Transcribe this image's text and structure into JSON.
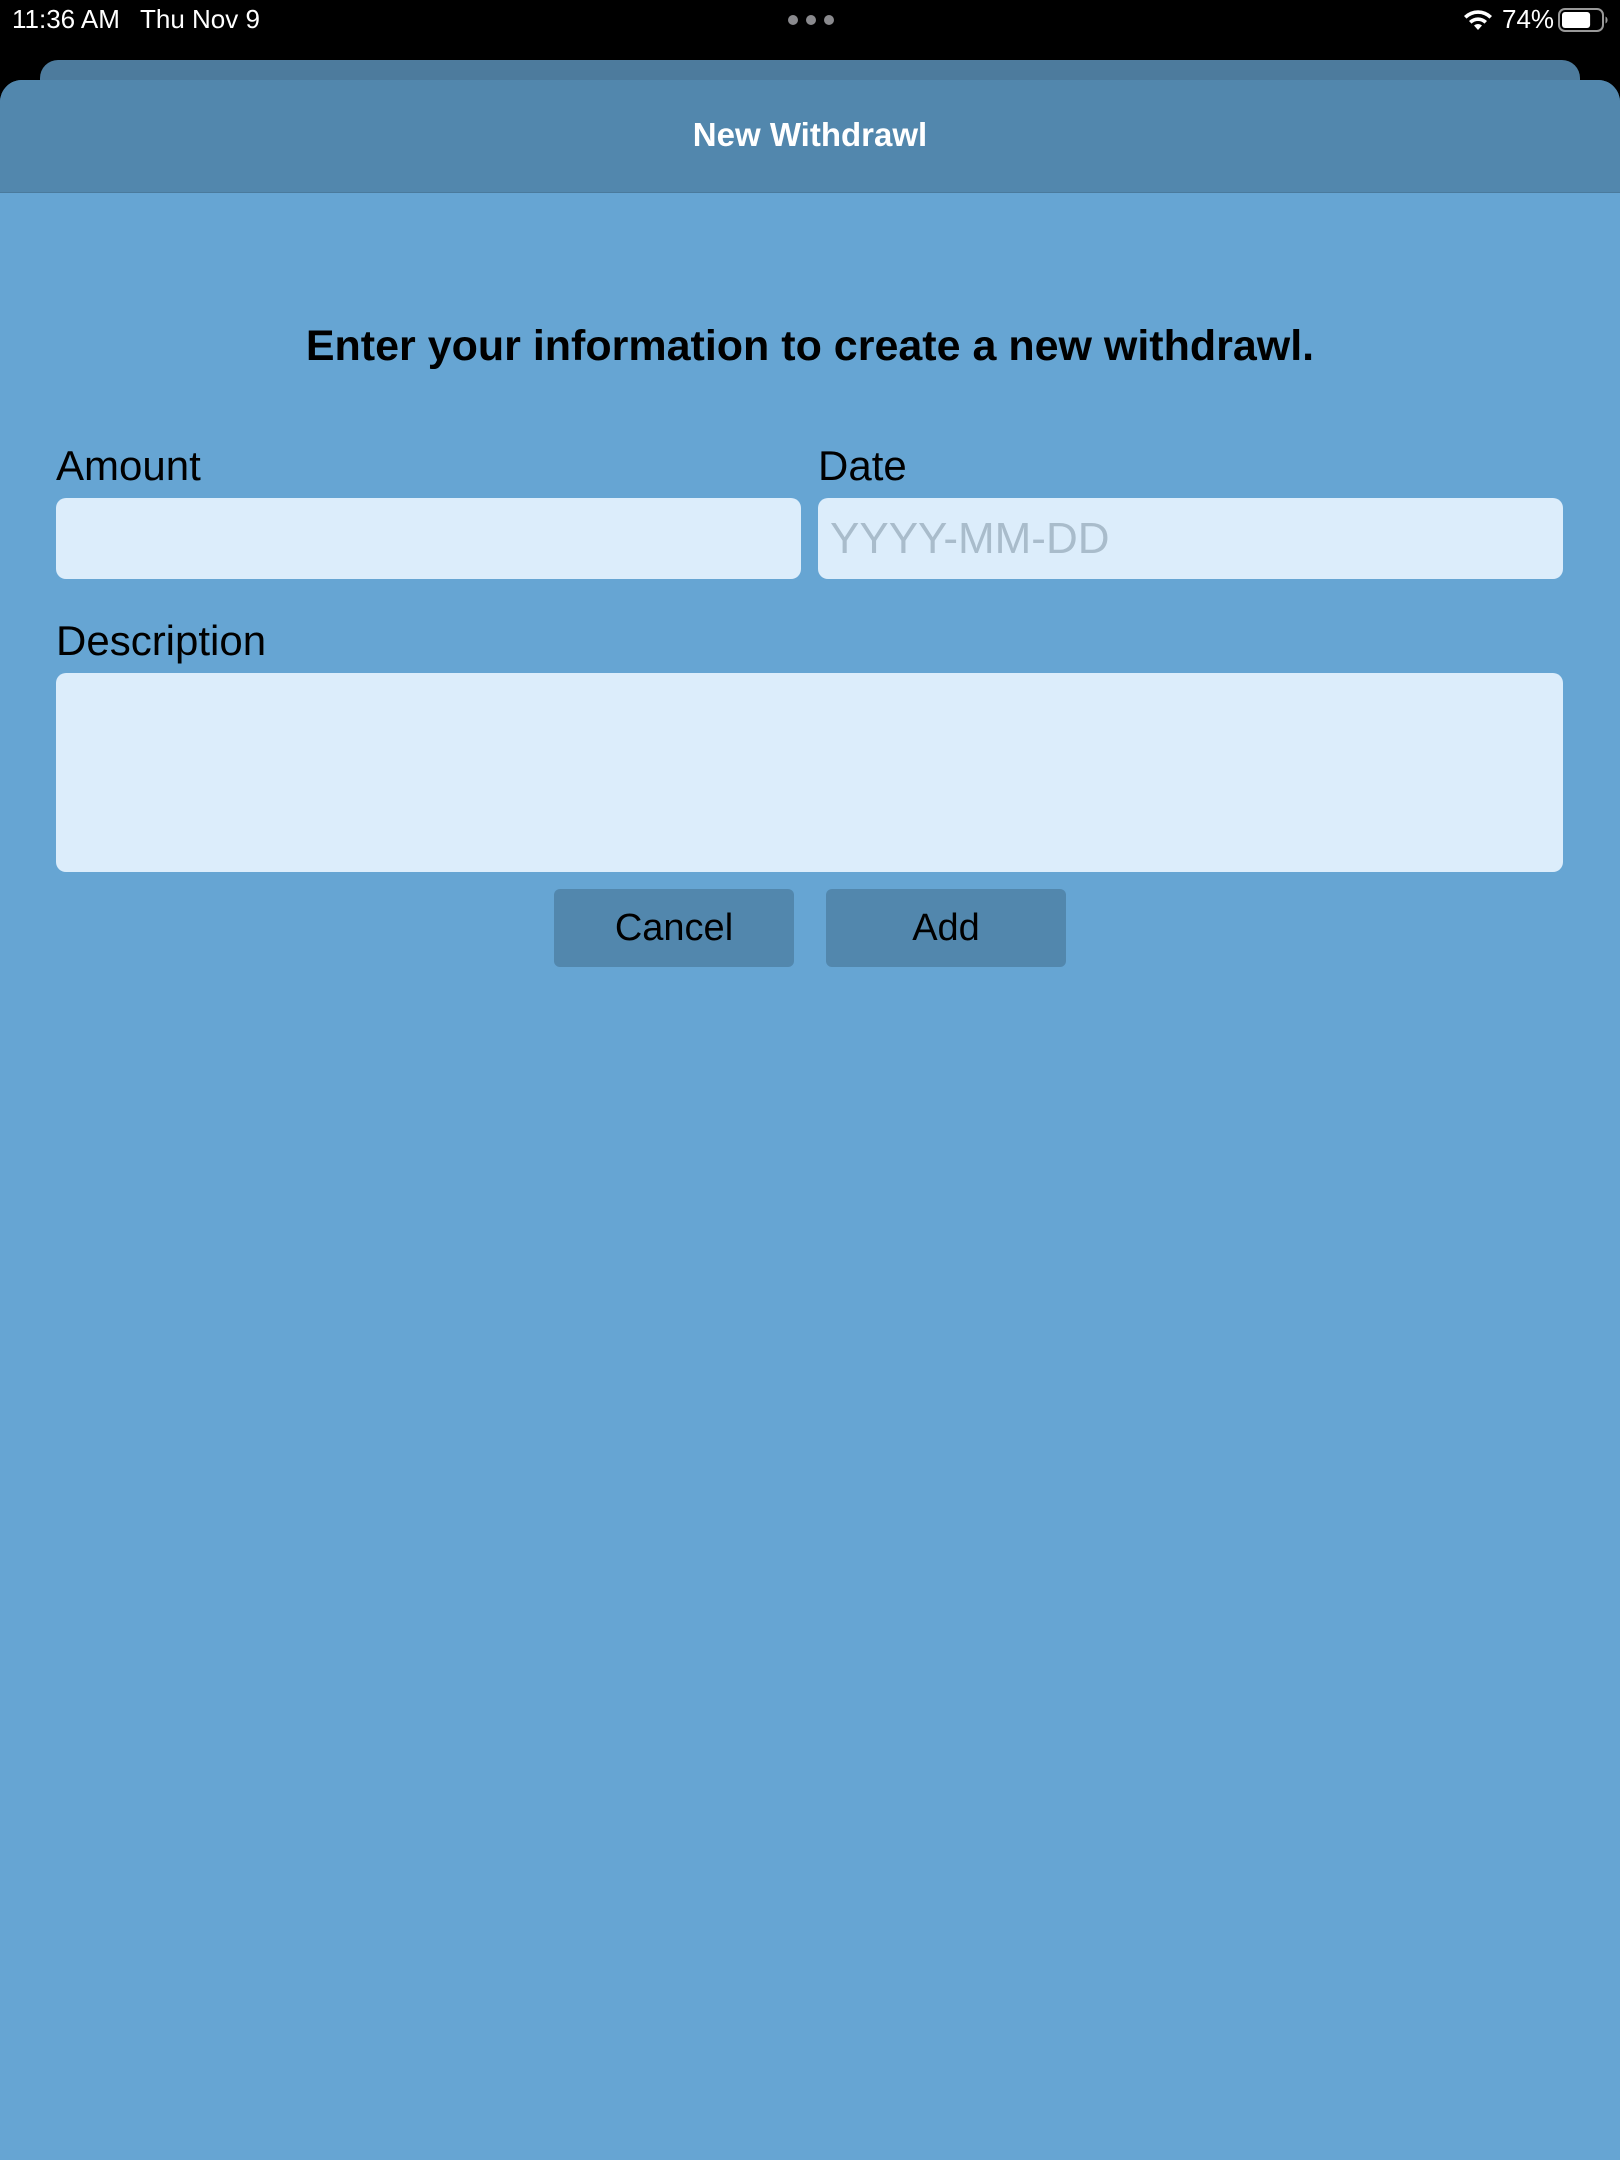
{
  "status_bar": {
    "time": "11:36 AM",
    "date": "Thu Nov 9",
    "battery_percent": "74%",
    "battery_level": 0.74,
    "wifi_icon": "wifi-icon",
    "battery_icon": "battery-icon",
    "multitask_icon": "more-dots-icon"
  },
  "nav": {
    "title": "New Withdrawl"
  },
  "form": {
    "heading": "Enter your information to create a new withdrawl.",
    "amount_label": "Amount",
    "amount_value": "",
    "date_label": "Date",
    "date_placeholder": "YYYY-MM-DD",
    "date_value": "",
    "description_label": "Description",
    "description_value": ""
  },
  "buttons": {
    "cancel_label": "Cancel",
    "add_label": "Add"
  },
  "colors": {
    "background": "#66a5d3",
    "nav_bar": "#5287ad",
    "input_fill": "#dcedfb",
    "button_fill": "#5287ad"
  }
}
